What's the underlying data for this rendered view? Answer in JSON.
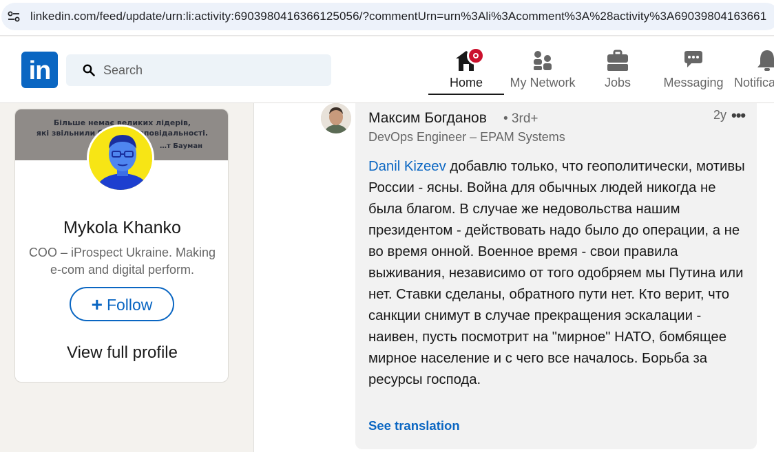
{
  "browser": {
    "url": "linkedin.com/feed/update/urn:li:activity:6903980416366125056/?commentUrn=urn%3Ali%3Acomment%3A%28activity%3A69039804163661"
  },
  "nav": {
    "logo_text": "in",
    "search_placeholder": "Search",
    "items": [
      {
        "label": "Home",
        "icon": "home-icon",
        "active": true
      },
      {
        "label": "My Network",
        "icon": "network-icon",
        "active": false
      },
      {
        "label": "Jobs",
        "icon": "briefcase-icon",
        "active": false
      },
      {
        "label": "Messaging",
        "icon": "message-icon",
        "active": false
      },
      {
        "label": "Notifica",
        "icon": "bell-icon",
        "active": false
      }
    ]
  },
  "profile_card": {
    "banner_quote_line1": "Більше немає великих лідерів,",
    "banner_quote_line2": "які звільнили б вас… відповідальності.",
    "banner_author": "…т Бауман",
    "name": "Mykola Khanko",
    "headline": "COO – iProspect Ukraine. Making e-com and digital perform.",
    "follow_label": "Follow",
    "view_profile_label": "View full profile"
  },
  "comment": {
    "author": "Максим Богданов",
    "degree": "• 3rd+",
    "title": "DevOps Engineer – EPAM Systems",
    "time": "2y",
    "more": "•••",
    "mention": "Danil Kizeev",
    "text": " добавлю только, что геополитически, мотивы России - ясны. Война для обычных людей никогда не была благом. В случае же недовольства нашим президентом - действовать надо было до операции, а не во время онной. Военное время - свои правила выживания, независимо от того одобряем мы Путина или нет. Ставки сделаны, обратного пути нет. Кто верит, что санкции снимут в случае прекращения эскалации - наивен, пусть посмотрит на \"мирное\" НАТО, бомбящее мирное население и с чего все началось. Борьба за ресурсы господа.",
    "see_translation": "See translation"
  },
  "colors": {
    "brand": "#0a66c2",
    "notification_badge": "#cb112d"
  }
}
